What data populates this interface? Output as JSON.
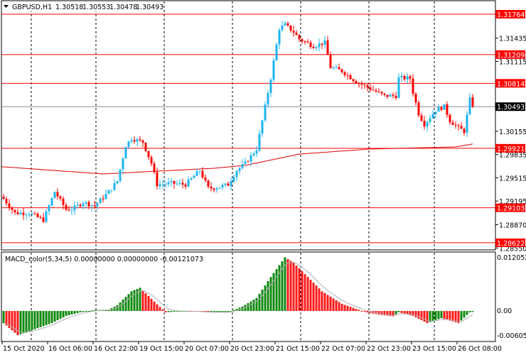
{
  "header": {
    "collapse_icon": "triangle-down-icon",
    "symbol": "GBPUSD,H1",
    "open": "1.30518",
    "high": "1.30553",
    "low": "1.30478",
    "close": "1.30493"
  },
  "colors": {
    "bull": "#1cb4f0",
    "bear": "#ff0000",
    "level_line": "#ff0000",
    "ma_line": "#e00000",
    "current_price_line": "#7f8c99",
    "macd_up": "#118a11",
    "macd_down": "#ff1a1a",
    "signal": "#b0b0b0"
  },
  "price_axis": {
    "ticks": [
      "1.31435",
      "1.31115",
      "1.30155",
      "1.29835",
      "1.29515",
      "1.29195",
      "1.28870",
      "1.28550"
    ],
    "levels": [
      "1.31764",
      "1.31209",
      "1.30814",
      "1.29921",
      "1.29103",
      "1.28622"
    ],
    "current_price": "1.30493"
  },
  "macd": {
    "label": "MACD_color(5,34,5) 0.00000000 0.00000000 -0.00121073",
    "ticks": [
      "0.0120526",
      "0.00",
      "-0.006053"
    ]
  },
  "time_axis": {
    "labels": [
      "15 Oct 2020",
      "16 Oct 06:00",
      "16 Oct 22:00",
      "19 Oct 15:00",
      "20 Oct 07:00",
      "20 Oct 23:00",
      "21 Oct 15:00",
      "22 Oct 07:00",
      "22 Oct 23:00",
      "23 Oct 15:00",
      "26 Oct 08:00"
    ]
  },
  "chart_data": {
    "type": "candlestick",
    "bars": 166,
    "price_keypoints": [
      [
        0,
        1.29226
      ],
      [
        4,
        1.29031
      ],
      [
        9,
        1.29031
      ],
      [
        14,
        1.28934
      ],
      [
        18,
        1.29324
      ],
      [
        22,
        1.2908
      ],
      [
        24,
        1.2908
      ],
      [
        28,
        1.29178
      ],
      [
        32,
        1.29129
      ],
      [
        37,
        1.29324
      ],
      [
        40,
        1.2947
      ],
      [
        43,
        1.29958
      ],
      [
        45,
        1.30056
      ],
      [
        49,
        1.30007
      ],
      [
        52,
        1.29714
      ],
      [
        54,
        1.29422
      ],
      [
        59,
        1.29441
      ],
      [
        64,
        1.29422
      ],
      [
        69,
        1.29617
      ],
      [
        72,
        1.29373
      ],
      [
        74,
        1.29373
      ],
      [
        79,
        1.29422
      ],
      [
        82,
        1.29617
      ],
      [
        85,
        1.29714
      ],
      [
        89,
        1.2991
      ],
      [
        92,
        1.30495
      ],
      [
        94,
        1.30886
      ],
      [
        97,
        1.31569
      ],
      [
        99,
        1.31618
      ],
      [
        102,
        1.3152
      ],
      [
        104,
        1.31422
      ],
      [
        109,
        1.31325
      ],
      [
        113,
        1.31374
      ],
      [
        115,
        1.31032
      ],
      [
        119,
        1.30983
      ],
      [
        124,
        1.30837
      ],
      [
        129,
        1.30739
      ],
      [
        134,
        1.30642
      ],
      [
        138,
        1.30642
      ],
      [
        139,
        1.30886
      ],
      [
        143,
        1.30886
      ],
      [
        144,
        1.3069
      ],
      [
        146,
        1.30398
      ],
      [
        148,
        1.30251
      ],
      [
        152,
        1.30446
      ],
      [
        155,
        1.30495
      ],
      [
        157,
        1.303
      ],
      [
        160,
        1.30202
      ],
      [
        162,
        1.30154
      ],
      [
        164,
        1.30593
      ],
      [
        165,
        1.30493
      ]
    ],
    "ma_keypoints": [
      [
        0,
        1.29666
      ],
      [
        35,
        1.29568
      ],
      [
        74,
        1.29646
      ],
      [
        85,
        1.29686
      ],
      [
        104,
        1.29841
      ],
      [
        129,
        1.29911
      ],
      [
        159,
        1.2994
      ],
      [
        165,
        1.2998
      ]
    ],
    "macd_keypoints": [
      [
        0,
        -0.0027
      ],
      [
        5,
        -0.0054
      ],
      [
        10,
        -0.0043
      ],
      [
        17,
        -0.0027
      ],
      [
        22,
        -0.0011
      ],
      [
        27,
        -0.0003
      ],
      [
        32,
        0.0002
      ],
      [
        37,
        0.0003
      ],
      [
        40,
        0.0013
      ],
      [
        45,
        0.0044
      ],
      [
        48,
        0.0052
      ],
      [
        53,
        0.0021
      ],
      [
        57,
        -0.0003
      ],
      [
        64,
        0.0
      ],
      [
        72,
        -0.0003
      ],
      [
        79,
        -0.0003
      ],
      [
        84,
        0.001
      ],
      [
        89,
        0.0029
      ],
      [
        94,
        0.0076
      ],
      [
        99,
        0.012
      ],
      [
        102,
        0.0108
      ],
      [
        107,
        0.0076
      ],
      [
        112,
        0.0044
      ],
      [
        119,
        0.0016
      ],
      [
        127,
        -0.0002
      ],
      [
        132,
        -0.0008
      ],
      [
        137,
        -0.0012
      ],
      [
        139,
        -0.0003
      ],
      [
        144,
        -0.0011
      ],
      [
        149,
        -0.0027
      ],
      [
        154,
        -0.0016
      ],
      [
        160,
        -0.0027
      ],
      [
        164,
        -0.0003
      ],
      [
        165,
        -0.0002
      ]
    ],
    "price_range": [
      1.2855,
      1.319
    ],
    "macd_range": [
      -0.0066,
      0.0126
    ]
  }
}
